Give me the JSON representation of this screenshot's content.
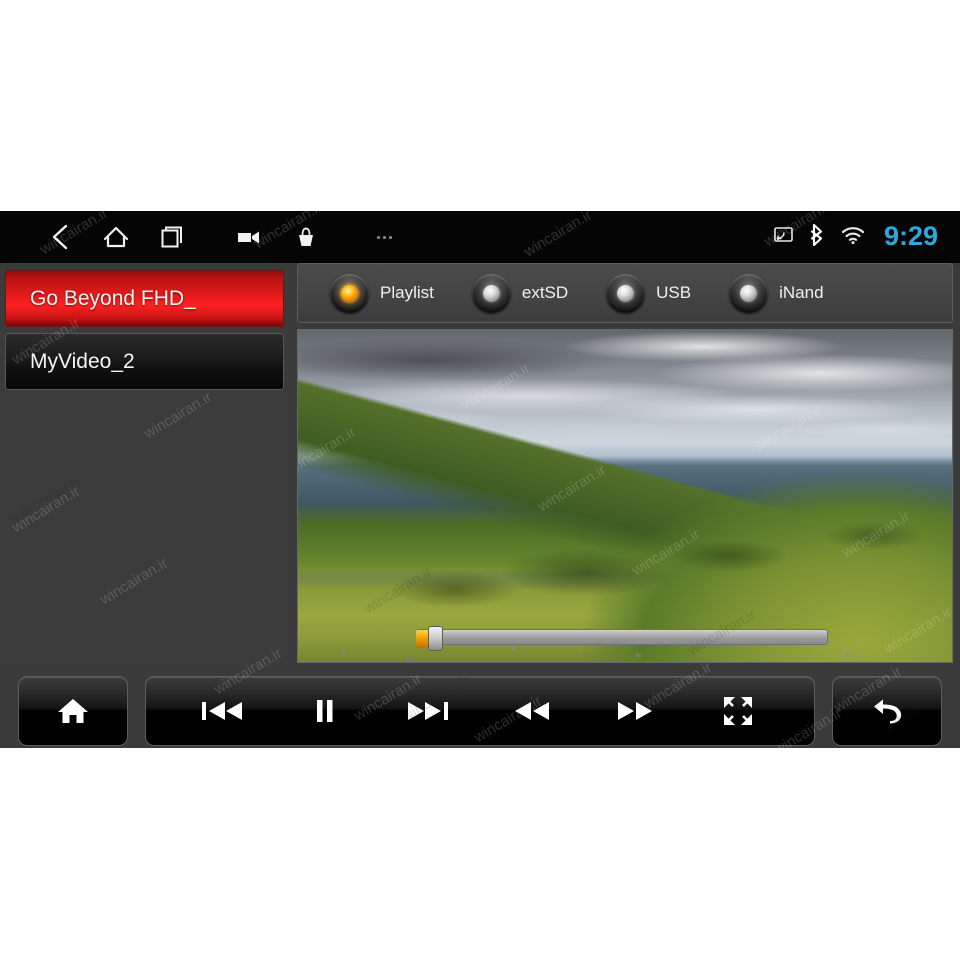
{
  "device": {
    "screen_bg": "#3a3a3a"
  },
  "statusbar": {
    "clock": "9:29",
    "clock_color": "#2fa8de",
    "left_icons": [
      {
        "name": "back-icon",
        "label": "Back"
      },
      {
        "name": "home-icon",
        "label": "Home"
      },
      {
        "name": "recents-icon",
        "label": "Recent apps"
      },
      {
        "name": "video-camera-icon",
        "label": "Camera"
      },
      {
        "name": "basket-icon",
        "label": "Apps"
      },
      {
        "name": "more-dots-icon",
        "label": "More"
      }
    ],
    "right_icons": [
      {
        "name": "cast-icon",
        "label": "Screen cast"
      },
      {
        "name": "bluetooth-icon",
        "label": "Bluetooth"
      },
      {
        "name": "wifi-icon",
        "label": "Wi-Fi"
      }
    ]
  },
  "playlist": {
    "items": [
      {
        "label": "Go Beyond FHD_",
        "selected": true
      },
      {
        "label": "MyVideo_2",
        "selected": false
      }
    ],
    "selected_color": "#e51a1a"
  },
  "sources": {
    "options": [
      {
        "label": "Playlist",
        "active": true
      },
      {
        "label": "extSD",
        "active": false
      },
      {
        "label": "USB",
        "active": false
      },
      {
        "label": "iNand",
        "active": false
      }
    ],
    "active_led_color": "#ffc422",
    "idle_led_color": "#dedede"
  },
  "video": {
    "title": "Go Beyond FHD_",
    "scene": "mountain-landscape",
    "seek": {
      "progress_percent": 3,
      "thumb_percent": 3
    }
  },
  "transport": {
    "home": {
      "label": "Home",
      "icon": "home-icon"
    },
    "back": {
      "label": "Back",
      "icon": "return-arrow-icon"
    },
    "media": [
      {
        "label": "Previous",
        "icon": "previous-track-icon"
      },
      {
        "label": "Pause",
        "icon": "pause-icon"
      },
      {
        "label": "Next",
        "icon": "next-track-icon"
      },
      {
        "label": "Rewind",
        "icon": "rewind-icon"
      },
      {
        "label": "Fast forward",
        "icon": "fast-forward-icon"
      },
      {
        "label": "Fullscreen",
        "icon": "fullscreen-icon"
      }
    ]
  },
  "watermark": {
    "text": "wincairan.ir"
  }
}
